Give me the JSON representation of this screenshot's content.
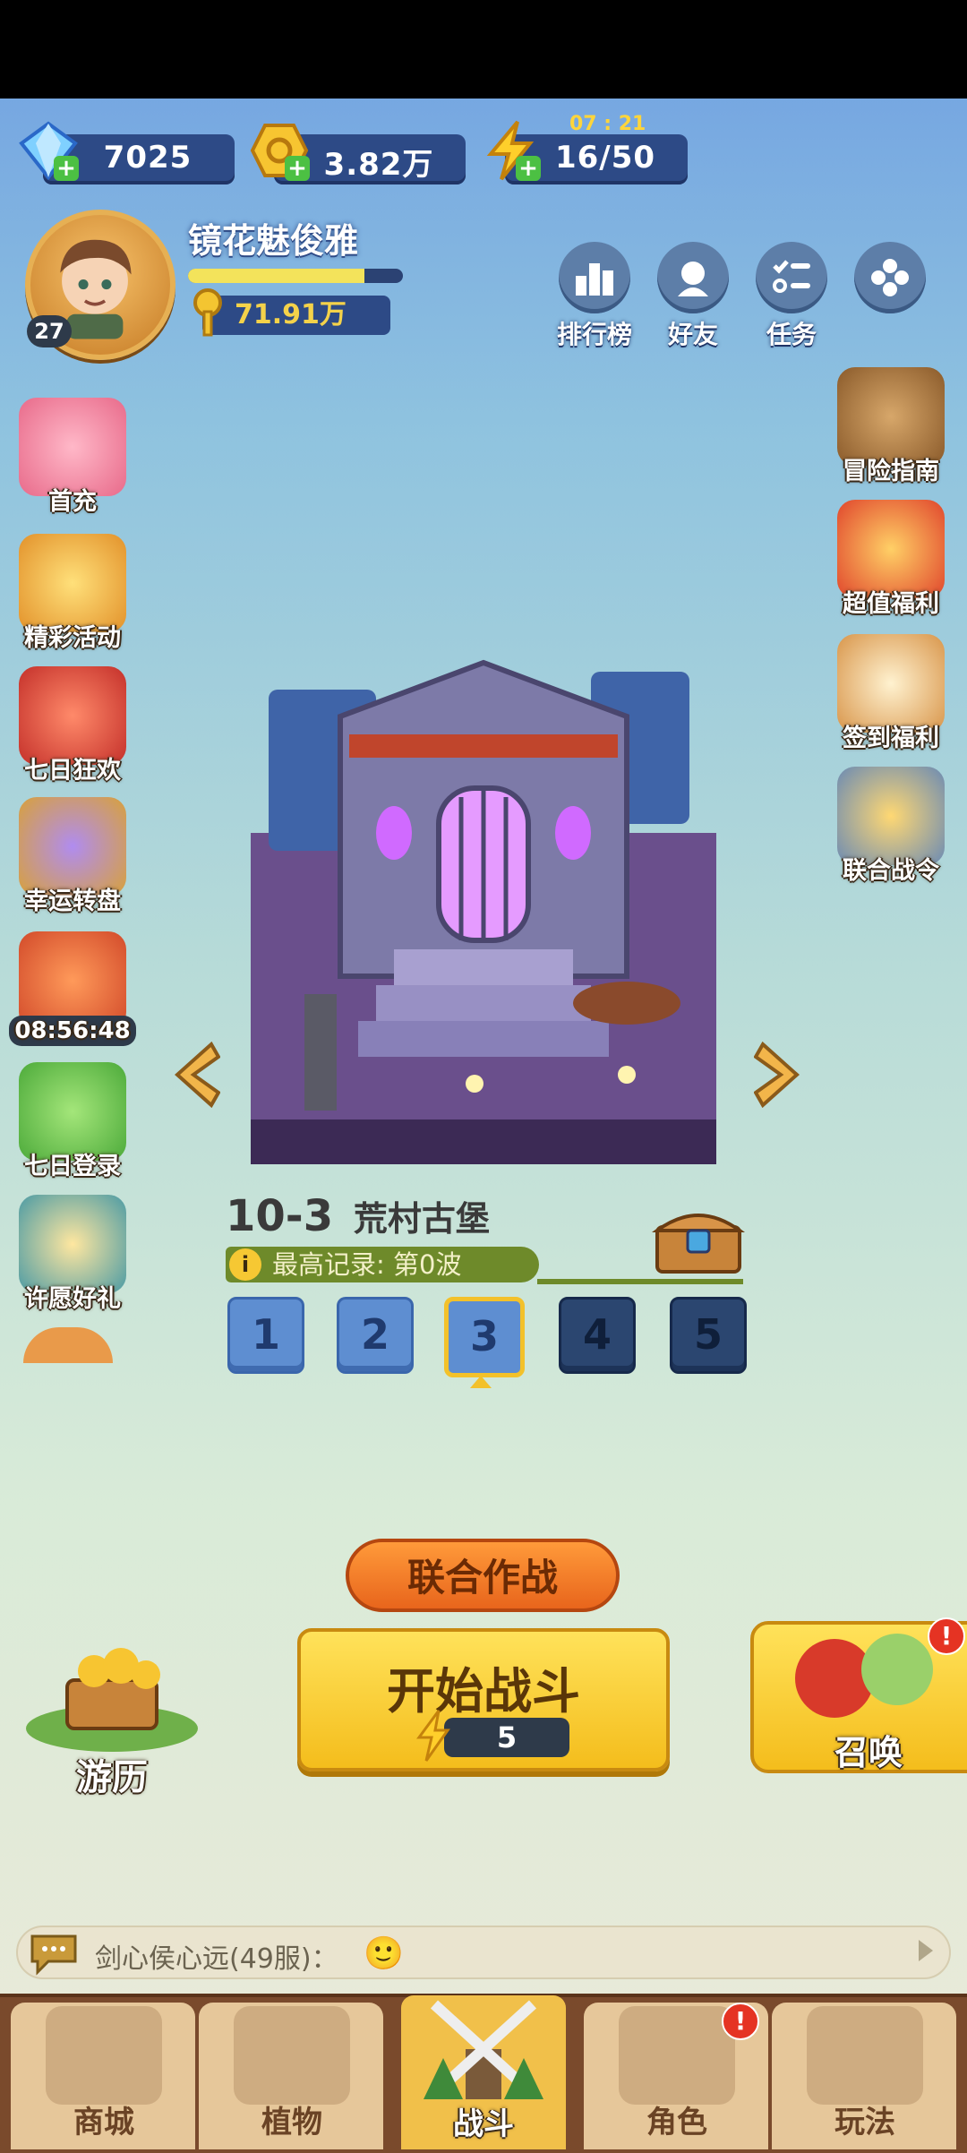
{
  "resources": {
    "gems": "7025",
    "coins": "3.82万",
    "energy": "16/50",
    "energy_timer": "07 : 21"
  },
  "profile": {
    "name": "镜花魅俊雅",
    "level": "27",
    "xp_progress": 0.82,
    "gold": "71.91万"
  },
  "top_buttons": [
    {
      "label": "排行榜",
      "icon": "leaderboard-icon"
    },
    {
      "label": "好友",
      "icon": "friends-icon"
    },
    {
      "label": "任务",
      "icon": "tasks-icon"
    },
    {
      "label": "",
      "icon": "more-menu-icon"
    }
  ],
  "left_menu": [
    {
      "label": "首充"
    },
    {
      "label": "精彩活动"
    },
    {
      "label": "七日狂欢"
    },
    {
      "label": "幸运转盘"
    },
    {
      "label": "08:56:48"
    },
    {
      "label": "七日登录"
    },
    {
      "label": "许愿好礼"
    }
  ],
  "right_menu": [
    {
      "label": "冒险指南"
    },
    {
      "label": "超值福利"
    },
    {
      "label": "签到福利"
    },
    {
      "label": "联合战令"
    }
  ],
  "stage": {
    "number": "10-3",
    "name": "荒村古堡",
    "record": "最高记录: 第0波",
    "waves": [
      "1",
      "2",
      "3",
      "4",
      "5"
    ],
    "current_wave": 3
  },
  "buttons": {
    "coop": "联合作战",
    "start": "开始战斗",
    "start_cost": "5",
    "travel": "游历",
    "summon": "召唤",
    "summon_badge": "!"
  },
  "chat": {
    "text": "剑心侯心远(49服)：",
    "emoji": "🙂"
  },
  "nav": [
    {
      "label": "商城"
    },
    {
      "label": "植物"
    },
    {
      "label": "战斗"
    },
    {
      "label": "角色",
      "badge": "!"
    },
    {
      "label": "玩法"
    }
  ],
  "colors": {
    "accent_yellow": "#f4bd1c",
    "accent_orange": "#e8651c",
    "panel_blue": "#2d4a86",
    "nav_brown": "#7a4a2c"
  }
}
